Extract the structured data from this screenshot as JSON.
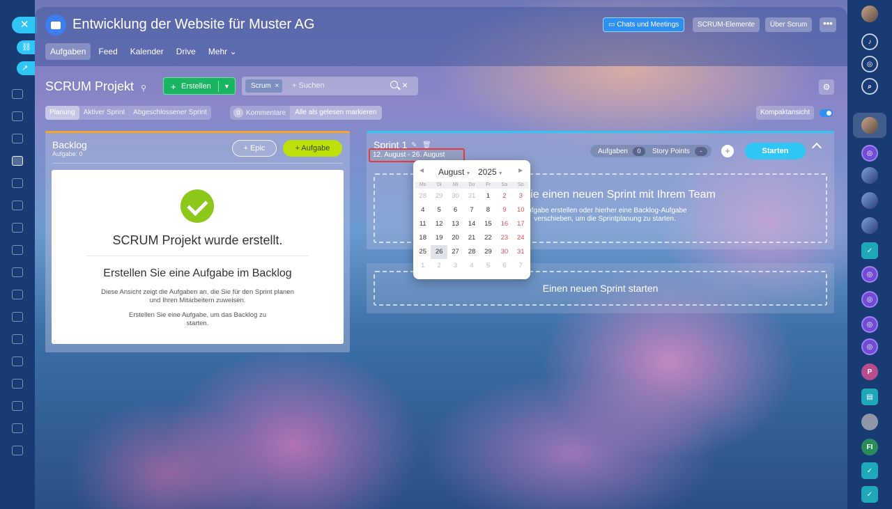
{
  "colors": {
    "accent_blue": "#2fc6f6",
    "create_green": "#19b562",
    "task_lime": "#bde00b",
    "backlog_border": "#f4a62e",
    "highlight_red": "#e63a3a",
    "check_green": "#8bc81a"
  },
  "header": {
    "title": "Entwicklung der Website für Muster AG",
    "buttons": {
      "chats": "Chats und Meetings",
      "scrum_elements": "SCRUM-Elemente",
      "about_scrum": "Über Scrum",
      "more": "•••"
    },
    "tabs": [
      {
        "label": "Aufgaben"
      },
      {
        "label": "Feed"
      },
      {
        "label": "Kalender"
      },
      {
        "label": "Drive"
      },
      {
        "label": "Mehr ⌄"
      }
    ]
  },
  "toolbar": {
    "project_title": "SCRUM Projekt",
    "create_label": "Erstellen",
    "search_chip": "Scrum",
    "search_placeholder": "+ Suchen"
  },
  "subtabs": [
    {
      "label": "Planung"
    },
    {
      "label": "Aktiver Sprint"
    },
    {
      "label": "Abgeschlossener Sprint"
    }
  ],
  "comments": {
    "count": "0",
    "label": "Kommentare",
    "mark_read": "Alle als gelesen markieren"
  },
  "compact_view": "Kompaktansicht",
  "backlog": {
    "title": "Backlog",
    "subtitle": "Aufgabe: 0",
    "epic_btn": "+  Epic",
    "task_btn": "+  Aufgabe",
    "empty_title": "SCRUM Projekt wurde erstellt.",
    "empty_heading": "Erstellen Sie eine Aufgabe im Backlog",
    "empty_text1": "Diese Ansicht zeigt die Aufgaben an, die Sie für den Sprint planen und Ihren Mitarbeitern zuweisen.",
    "empty_text2": "Erstellen Sie eine Aufgabe, um das Backlog zu starten."
  },
  "sprint": {
    "name": "Sprint 1",
    "dates": "12. August - 26. August",
    "tasks_label": "Aufgaben",
    "tasks_count": "0",
    "story_points_label": "Story Points",
    "story_points_value": "-",
    "start_btn": "Starten",
    "drop_title": "Planen Sie einen neuen Sprint mit Ihrem Team",
    "drop_text": "Aufgabe erstellen oder hierher eine Backlog-Aufgabe verschieben, um die Sprintplanung zu starten."
  },
  "new_sprint": "Einen neuen Sprint starten",
  "calendar": {
    "month": "August",
    "year": "2025",
    "weekdays": [
      "Mo",
      "Di",
      "Mi",
      "Do",
      "Fr",
      "Sa",
      "So"
    ],
    "weeks": [
      [
        "28",
        "29",
        "30",
        "31",
        "1",
        "2",
        "3"
      ],
      [
        "4",
        "5",
        "6",
        "7",
        "8",
        "9",
        "10"
      ],
      [
        "11",
        "12",
        "13",
        "14",
        "15",
        "16",
        "17"
      ],
      [
        "18",
        "19",
        "20",
        "21",
        "22",
        "23",
        "24"
      ],
      [
        "25",
        "26",
        "27",
        "28",
        "29",
        "30",
        "31"
      ],
      [
        "1",
        "2",
        "3",
        "4",
        "5",
        "6",
        "7"
      ]
    ],
    "selected_day": "26"
  },
  "right_rail": {
    "avatar_p": "P",
    "avatar_fi": "FI"
  }
}
